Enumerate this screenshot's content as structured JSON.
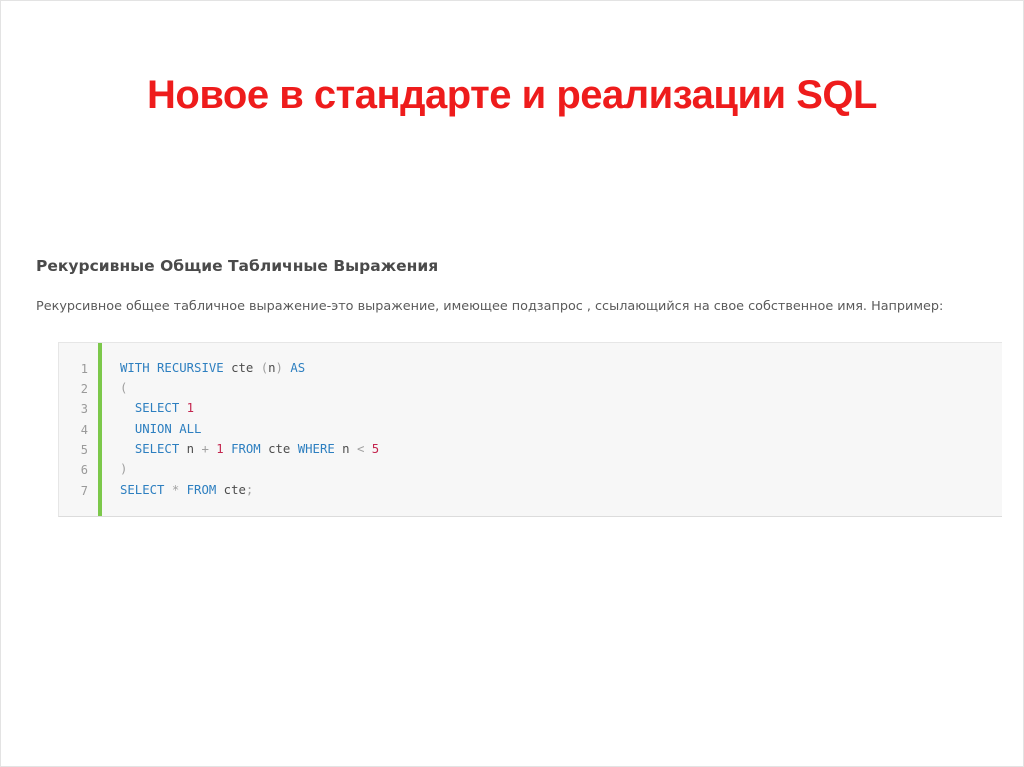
{
  "slide": {
    "title": "Новое в стандарте и реализации SQL",
    "title_color": "#ee1c1c"
  },
  "section": {
    "heading": "Рекурсивные Общие Табличные Выражения",
    "paragraph": "Рекурсивное общее табличное выражение-это выражение, имеющее подзапрос , ссылающийся на свое собственное имя. Например:"
  },
  "code": {
    "accent_color": "#7cc84a",
    "line_numbers": [
      "1",
      "2",
      "3",
      "4",
      "5",
      "6",
      "7"
    ],
    "lines": [
      [
        {
          "t": "kw",
          "v": "WITH"
        },
        {
          "t": "sp",
          "v": " "
        },
        {
          "t": "kw",
          "v": "RECURSIVE"
        },
        {
          "t": "sp",
          "v": " "
        },
        {
          "t": "id",
          "v": "cte"
        },
        {
          "t": "sp",
          "v": " "
        },
        {
          "t": "op",
          "v": "("
        },
        {
          "t": "id",
          "v": "n"
        },
        {
          "t": "op",
          "v": ")"
        },
        {
          "t": "sp",
          "v": " "
        },
        {
          "t": "kw",
          "v": "AS"
        }
      ],
      [
        {
          "t": "op",
          "v": "("
        }
      ],
      [
        {
          "t": "sp",
          "v": "  "
        },
        {
          "t": "kw",
          "v": "SELECT"
        },
        {
          "t": "sp",
          "v": " "
        },
        {
          "t": "num",
          "v": "1"
        }
      ],
      [
        {
          "t": "sp",
          "v": "  "
        },
        {
          "t": "kw",
          "v": "UNION"
        },
        {
          "t": "sp",
          "v": " "
        },
        {
          "t": "kw",
          "v": "ALL"
        }
      ],
      [
        {
          "t": "sp",
          "v": "  "
        },
        {
          "t": "kw",
          "v": "SELECT"
        },
        {
          "t": "sp",
          "v": " "
        },
        {
          "t": "id",
          "v": "n"
        },
        {
          "t": "sp",
          "v": " "
        },
        {
          "t": "op",
          "v": "+"
        },
        {
          "t": "sp",
          "v": " "
        },
        {
          "t": "num",
          "v": "1"
        },
        {
          "t": "sp",
          "v": " "
        },
        {
          "t": "kw",
          "v": "FROM"
        },
        {
          "t": "sp",
          "v": " "
        },
        {
          "t": "id",
          "v": "cte"
        },
        {
          "t": "sp",
          "v": " "
        },
        {
          "t": "kw",
          "v": "WHERE"
        },
        {
          "t": "sp",
          "v": " "
        },
        {
          "t": "id",
          "v": "n"
        },
        {
          "t": "sp",
          "v": " "
        },
        {
          "t": "op",
          "v": "<"
        },
        {
          "t": "sp",
          "v": " "
        },
        {
          "t": "num",
          "v": "5"
        }
      ],
      [
        {
          "t": "op",
          "v": ")"
        }
      ],
      [
        {
          "t": "kw",
          "v": "SELECT"
        },
        {
          "t": "sp",
          "v": " "
        },
        {
          "t": "op",
          "v": "*"
        },
        {
          "t": "sp",
          "v": " "
        },
        {
          "t": "kw",
          "v": "FROM"
        },
        {
          "t": "sp",
          "v": " "
        },
        {
          "t": "id",
          "v": "cte"
        },
        {
          "t": "op",
          "v": ";"
        }
      ]
    ]
  }
}
